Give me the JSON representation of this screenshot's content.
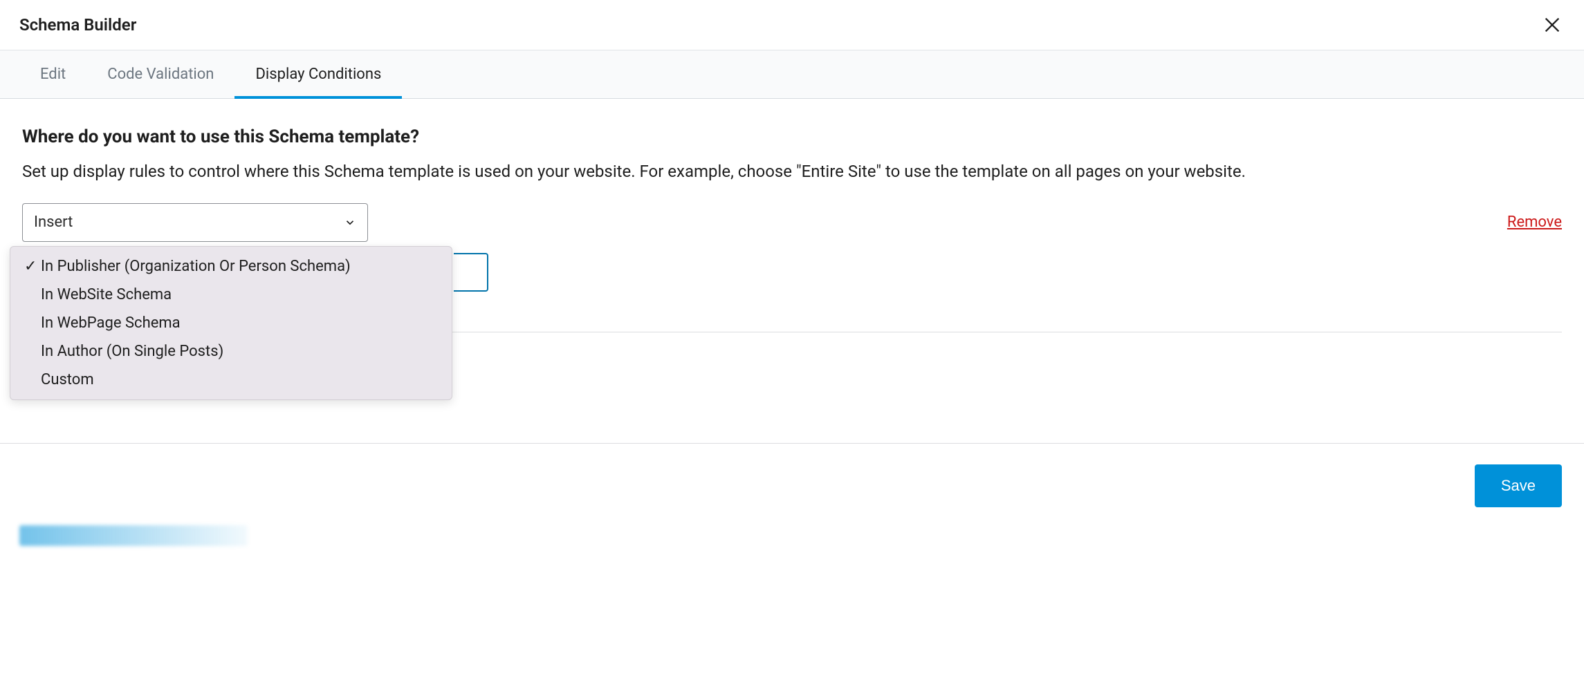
{
  "header": {
    "title": "Schema Builder"
  },
  "tabs": [
    {
      "label": "Edit"
    },
    {
      "label": "Code Validation"
    },
    {
      "label": "Display Conditions"
    }
  ],
  "active_tab_index": 2,
  "section": {
    "heading": "Where do you want to use this Schema template?",
    "description": "Set up display rules to control where this Schema template is used on your website. For example, choose \"Entire Site\" to use the template on all pages on your website."
  },
  "rule": {
    "select_value": "Insert",
    "remove_label": "Remove"
  },
  "dropdown": {
    "selected_index": 0,
    "options": [
      "In Publisher (Organization Or Person Schema)",
      "In WebSite Schema",
      "In WebPage Schema",
      "In Author (On Single Posts)",
      "Custom"
    ]
  },
  "footer": {
    "save_label": "Save"
  }
}
